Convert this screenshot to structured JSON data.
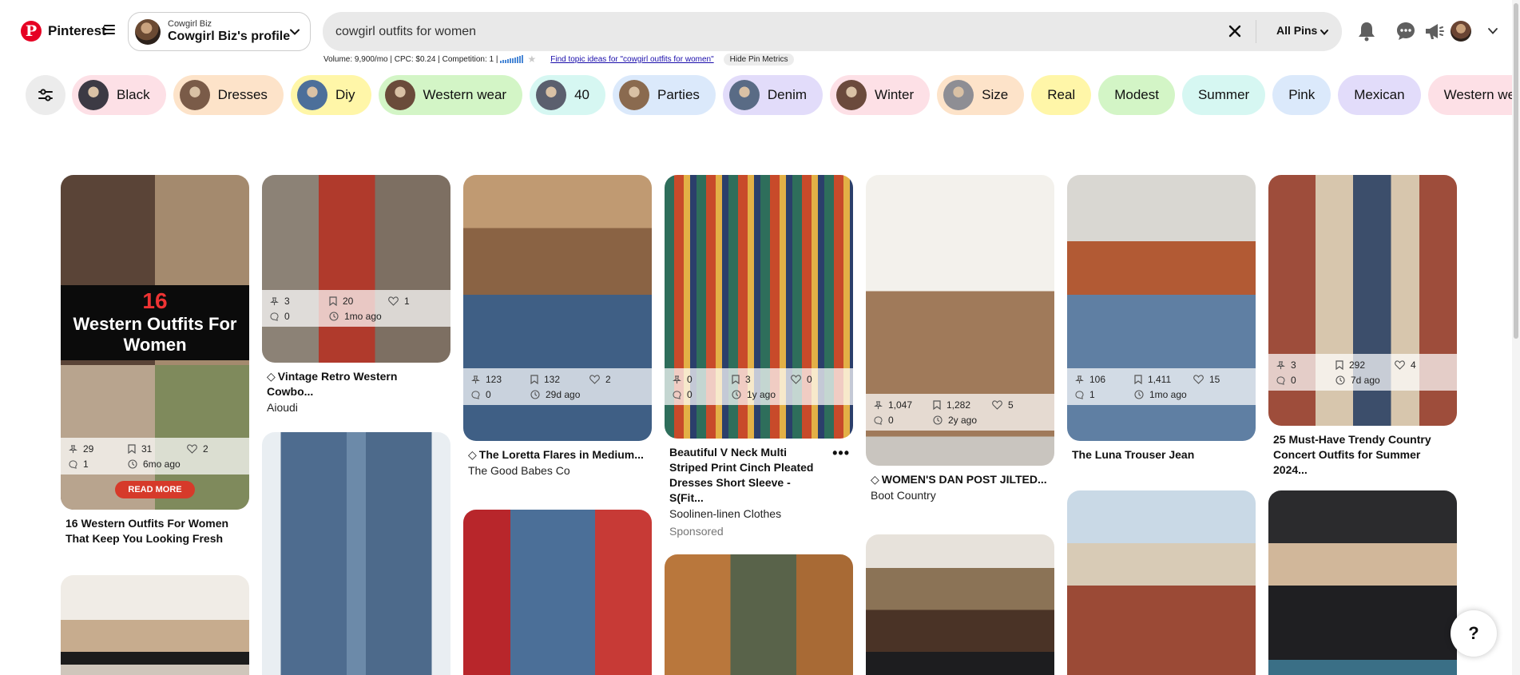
{
  "header": {
    "logo_text": "Pinterest",
    "profile_small": "Cowgirl Biz",
    "profile_name": "Cowgirl Biz's profile",
    "search_value": "cowgirl outfits for women",
    "scope_label": "All Pins"
  },
  "metrics": {
    "summary": "Volume: 9,900/mo | CPC: $0.24 | Competition: 1 |",
    "topic_link": "Find topic ideas for \"cowgirl outfits for women\"",
    "hide_label": "Hide Pin Metrics"
  },
  "chips": [
    {
      "label": "Black",
      "color": "#fde0e6",
      "thumb": "#3c3a44"
    },
    {
      "label": "Dresses",
      "color": "#fde3c9",
      "thumb": "#7a5b48"
    },
    {
      "label": "Diy",
      "color": "#fff6a8",
      "thumb": "#4c6f9a"
    },
    {
      "label": "Western wear",
      "color": "#d3f5c6",
      "thumb": "#6a4b3a"
    },
    {
      "label": "40",
      "color": "#d6f7f2",
      "thumb": "#5b5f6e"
    },
    {
      "label": "Parties",
      "color": "#dbe9fb",
      "thumb": "#8a6a4f"
    },
    {
      "label": "Denim",
      "color": "#e2dcfa",
      "thumb": "#596b85"
    },
    {
      "label": "Winter",
      "color": "#fde0e6",
      "thumb": "#6b4a3c"
    },
    {
      "label": "Size",
      "color": "#fde3c9",
      "thumb": "#8e8e94"
    },
    {
      "label": "Real",
      "color": "#fff6a8",
      "thumb": ""
    },
    {
      "label": "Modest",
      "color": "#d3f5c6",
      "thumb": ""
    },
    {
      "label": "Summer",
      "color": "#d6f7f2",
      "thumb": ""
    },
    {
      "label": "Pink",
      "color": "#dbe9fb",
      "thumb": ""
    },
    {
      "label": "Mexican",
      "color": "#e2dcfa",
      "thumb": ""
    },
    {
      "label": "Western wear country lor",
      "color": "#fde0e6",
      "thumb": ""
    }
  ],
  "pins": [
    {
      "id": "p1",
      "stats": {
        "saves": "29",
        "repins": "31",
        "likes": "2",
        "comments": "1",
        "age": "6mo ago"
      },
      "banner_number": "16",
      "banner_text": "Western Outfits For Women",
      "readmore": "READ MORE",
      "title": "16 Western Outfits For Women That Keep You Looking Fresh"
    },
    {
      "id": "p2",
      "stats": {
        "saves": "3",
        "repins": "20",
        "likes": "1",
        "comments": "0",
        "age": "1mo ago"
      },
      "title": "Vintage Retro Western Cowbo...",
      "source": "Aioudi"
    },
    {
      "id": "p3",
      "stats": {
        "saves": "123",
        "repins": "132",
        "likes": "2",
        "comments": "0",
        "age": "29d ago"
      },
      "title": "The Loretta Flares in Medium...",
      "source": "The Good Babes Co"
    },
    {
      "id": "p4",
      "stats": {
        "saves": "0",
        "repins": "3",
        "likes": "0",
        "comments": "0",
        "age": "1y ago"
      },
      "title": "Beautiful V Neck Multi Striped Print Cinch Pleated Dresses Short Sleeve - S(Fit...",
      "source": "Soolinen-linen Clothes",
      "sponsored": "Sponsored"
    },
    {
      "id": "p5",
      "stats": {
        "saves": "1,047",
        "repins": "1,282",
        "likes": "5",
        "comments": "0",
        "age": "2y ago"
      },
      "title": "WOMEN'S DAN POST JILTED...",
      "source": "Boot Country"
    },
    {
      "id": "p6",
      "stats": {
        "saves": "106",
        "repins": "1,411",
        "likes": "15",
        "comments": "1",
        "age": "1mo ago"
      },
      "title": "The Luna Trouser Jean"
    },
    {
      "id": "p7",
      "stats": {
        "saves": "3",
        "repins": "292",
        "likes": "4",
        "comments": "0",
        "age": "7d ago"
      },
      "title": "25 Must-Have Trendy Country Concert Outfits for Summer 2024..."
    }
  ],
  "help_label": "?",
  "colors": {
    "brand": "#e60023",
    "search_bg": "#e9e9e9",
    "link": "#1a0dab"
  }
}
